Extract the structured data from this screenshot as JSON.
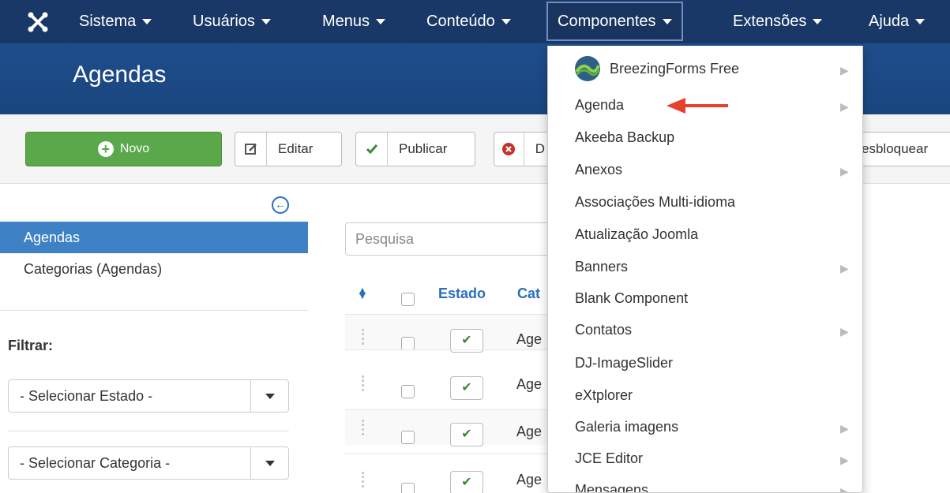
{
  "navbar": {
    "logo_icon": "joomla-logo-icon",
    "items": [
      {
        "label": "Sistema"
      },
      {
        "label": "Usuários"
      },
      {
        "label": "Menus"
      },
      {
        "label": "Conteúdo"
      },
      {
        "label": "Componentes"
      },
      {
        "label": "Extensões"
      },
      {
        "label": "Ajuda"
      }
    ]
  },
  "page": {
    "title": "Agendas"
  },
  "toolbar": {
    "new_label": "Novo",
    "edit_label": "Editar",
    "publish_label": "Publicar",
    "unpublish_partial": "D",
    "unlock_partial": "esbloquear"
  },
  "sidebar": {
    "items": [
      {
        "label": "Agendas",
        "active": true
      },
      {
        "label": "Categorias (Agendas)",
        "active": false
      }
    ],
    "filter_label": "Filtrar:",
    "selects": [
      {
        "value": "- Selecionar Estado -"
      },
      {
        "value": "- Selecionar Categoria -"
      }
    ]
  },
  "main": {
    "search_placeholder": "Pesquisa",
    "columns": {
      "status": "Estado",
      "category_partial": "Cat"
    },
    "rows": [
      {
        "text": "Age"
      },
      {
        "text": "Age"
      },
      {
        "text": "Age"
      },
      {
        "text": "Age"
      }
    ]
  },
  "dropdown": {
    "items": [
      {
        "label": "BreezingForms Free",
        "submenu": true
      },
      {
        "label": "Agenda",
        "submenu": true
      },
      {
        "label": "Akeeba Backup",
        "submenu": false
      },
      {
        "label": "Anexos",
        "submenu": true
      },
      {
        "label": "Associações Multi-idioma",
        "submenu": false
      },
      {
        "label": "Atualização Joomla",
        "submenu": false
      },
      {
        "label": "Banners",
        "submenu": true
      },
      {
        "label": "Blank Component",
        "submenu": false
      },
      {
        "label": "Contatos",
        "submenu": true
      },
      {
        "label": "DJ-ImageSlider",
        "submenu": false
      },
      {
        "label": "eXtplorer",
        "submenu": false
      },
      {
        "label": "Galeria imagens",
        "submenu": true
      },
      {
        "label": "JCE Editor",
        "submenu": true
      },
      {
        "label": "Mensagens",
        "submenu": true
      }
    ]
  },
  "colors": {
    "navbar": "#1a3867",
    "titlebar": "#1d4b8a",
    "accent": "#3e81c4",
    "new_button": "#5aa84a",
    "arrow": "#e8402f"
  }
}
